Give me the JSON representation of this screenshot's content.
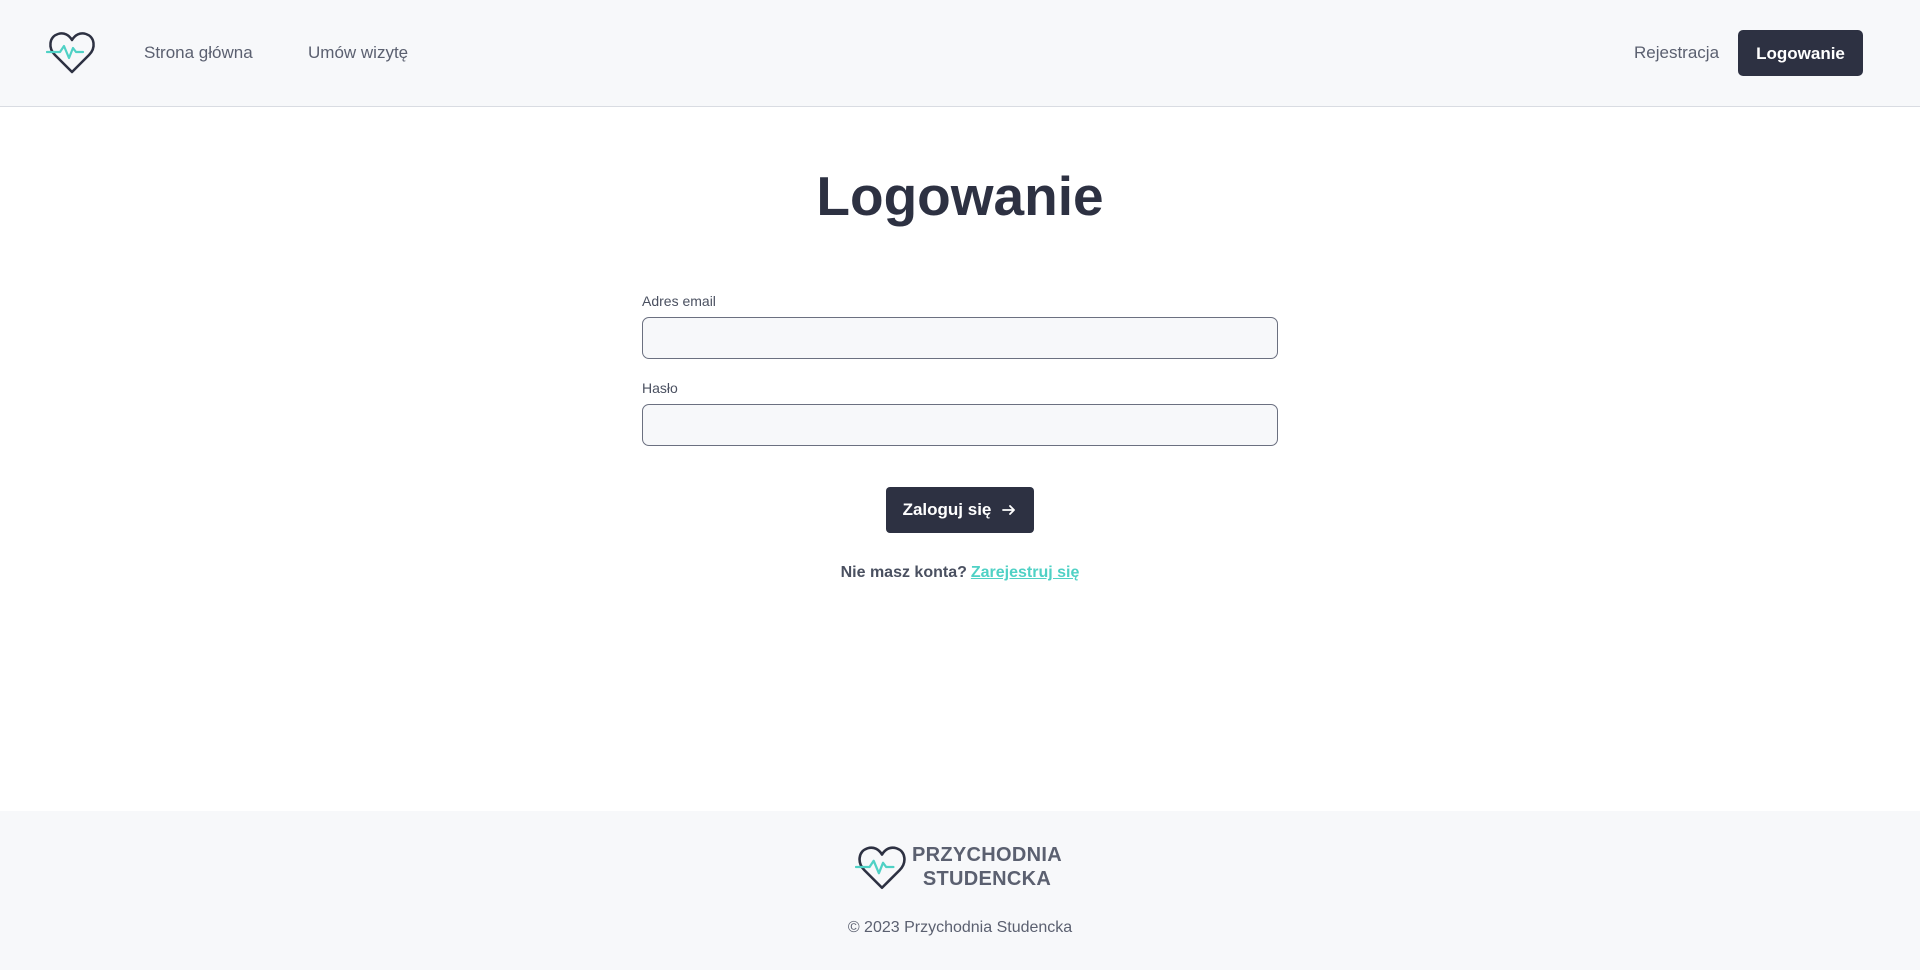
{
  "colors": {
    "primary": "#2d3142",
    "accent": "#4fd1c5",
    "header_bg": "#f7f8fa",
    "text_muted": "#5b6070"
  },
  "header": {
    "logo_icon": "heart-pulse-icon",
    "nav": {
      "home": "Strona główna",
      "visit": "Umów wizytę",
      "register": "Rejestracja",
      "login": "Logowanie"
    }
  },
  "main": {
    "title": "Logowanie",
    "form": {
      "email_label": "Adres email",
      "email_value": "",
      "password_label": "Hasło",
      "password_value": "",
      "submit_label": "Zaloguj się",
      "submit_icon": "arrow-right-icon"
    },
    "signup": {
      "prompt": "Nie masz konta?",
      "link": "Zarejestruj się"
    }
  },
  "footer": {
    "brand_line1": "PRZYCHODNIA",
    "brand_line2": "STUDENCKA",
    "copyright": "© 2023 Przychodnia Studencka"
  }
}
